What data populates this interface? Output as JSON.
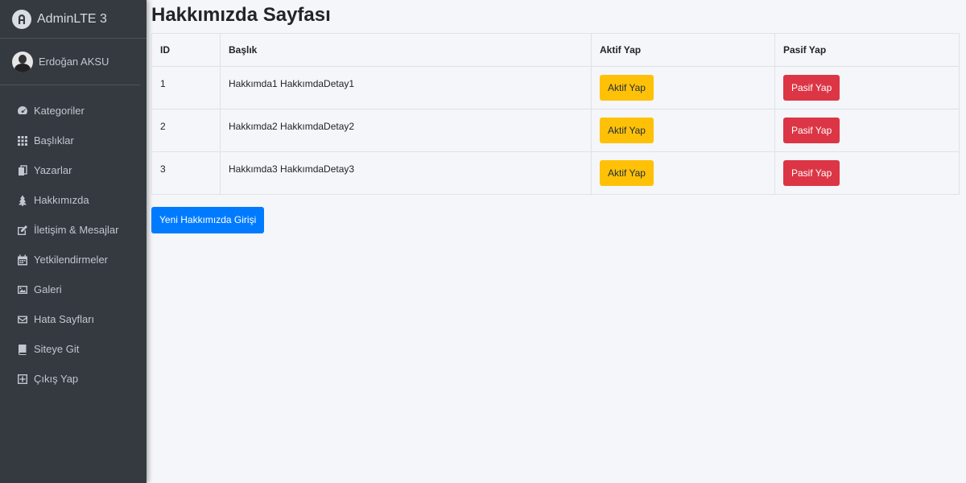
{
  "app": {
    "brand": "AdminLTE 3",
    "user": "Erdoğan AKSU"
  },
  "sidebar": {
    "items": [
      {
        "label": "Kategoriler",
        "icon": "tachometer-icon"
      },
      {
        "label": "Başlıklar",
        "icon": "grid-icon"
      },
      {
        "label": "Yazarlar",
        "icon": "copy-icon"
      },
      {
        "label": "Hakkımızda",
        "icon": "tree-icon"
      },
      {
        "label": "İletişim & Mesajlar",
        "icon": "edit-icon"
      },
      {
        "label": "Yetkilendirmeler",
        "icon": "calendar-icon"
      },
      {
        "label": "Galeri",
        "icon": "image-icon"
      },
      {
        "label": "Hata Sayfları",
        "icon": "envelope-icon"
      },
      {
        "label": "Siteye Git",
        "icon": "book-icon"
      },
      {
        "label": "Çıkış Yap",
        "icon": "plus-square-icon"
      }
    ]
  },
  "main": {
    "title": "Hakkımızda Sayfası",
    "table": {
      "headers": [
        "ID",
        "Başlık",
        "Aktif Yap",
        "Pasif Yap"
      ],
      "rows": [
        {
          "id": "1",
          "title": "Hakkımda1 HakkımdaDetay1",
          "aktif": "Aktif Yap",
          "pasif": "Pasif Yap"
        },
        {
          "id": "2",
          "title": "Hakkımda2 HakkımdaDetay2",
          "aktif": "Aktif Yap",
          "pasif": "Pasif Yap"
        },
        {
          "id": "3",
          "title": "Hakkımda3 HakkımdaDetay3",
          "aktif": "Aktif Yap",
          "pasif": "Pasif Yap"
        }
      ]
    },
    "new_button": "Yeni Hakkımızda Girişi"
  },
  "colors": {
    "sidebar": "#343a40",
    "warning": "#ffc107",
    "danger": "#dc3545",
    "primary": "#007bff"
  }
}
